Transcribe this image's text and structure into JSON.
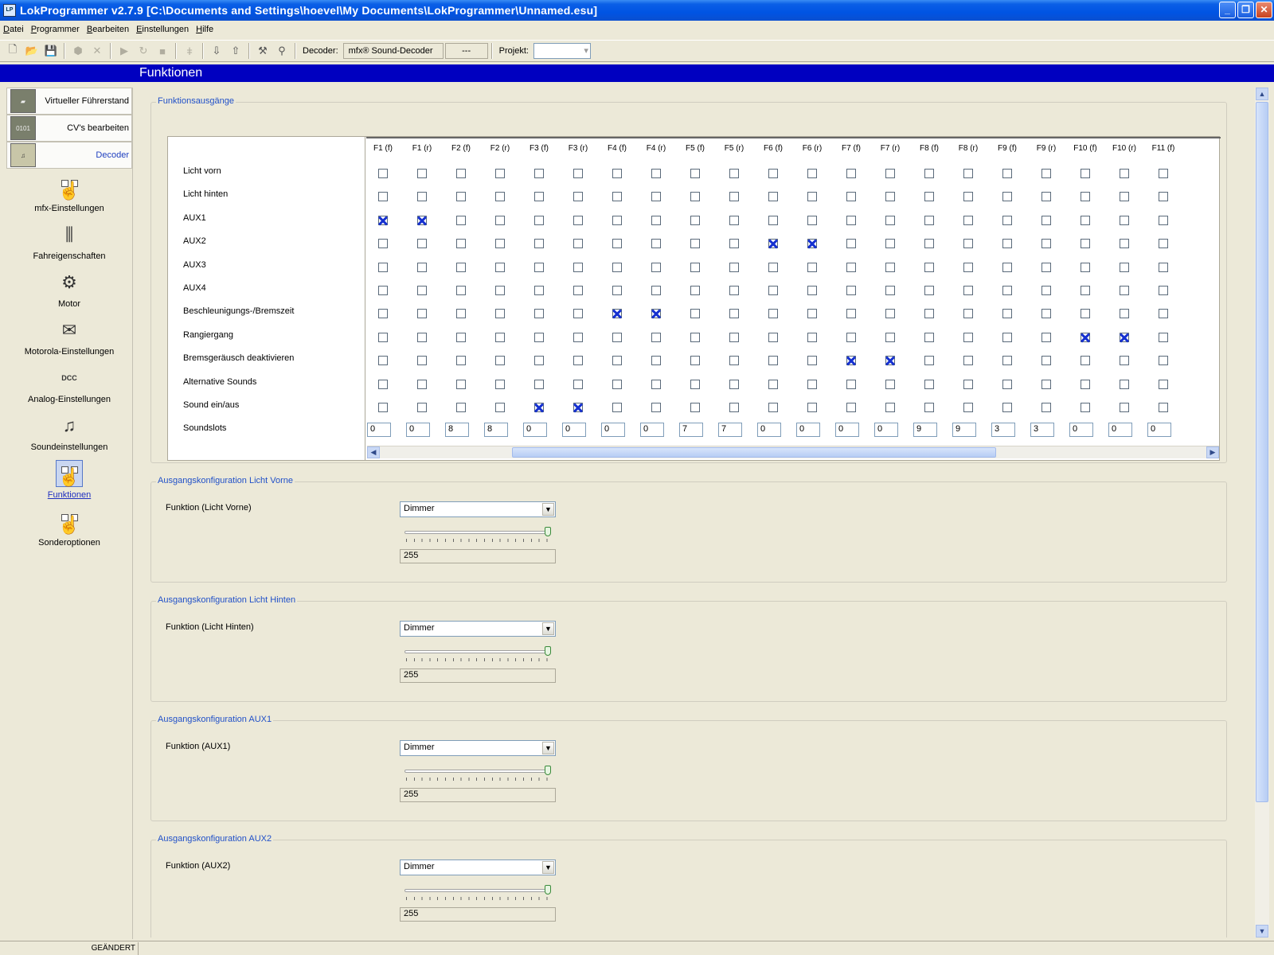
{
  "window": {
    "title": "LokProgrammer  v2.7.9  [C:\\Documents and Settings\\hoevel\\My Documents\\LokProgrammer\\Unnamed.esu]",
    "icon_text": "LP"
  },
  "menu": [
    "Datei",
    "Programmer",
    "Bearbeiten",
    "Einstellungen",
    "Hilfe"
  ],
  "toolbar": {
    "decoder_label": "Decoder:",
    "decoder_value": "mfx® Sound-Decoder",
    "decoder_extra": "---",
    "projekt_label": "Projekt:"
  },
  "header": {
    "title": "Funktionen"
  },
  "sidebar": {
    "top": [
      {
        "label": "Virtueller Führerstand",
        "active": false
      },
      {
        "label": "CV's bearbeiten",
        "active": false
      },
      {
        "label": "Decoder",
        "active": true
      }
    ],
    "items": [
      {
        "label": "mfx-Einstellungen",
        "icon": "mfx-icon"
      },
      {
        "label": "Fahreigenschaften",
        "icon": "sliders-icon"
      },
      {
        "label": "Motor",
        "icon": "motor-icon"
      },
      {
        "label": "Motorola-Einstellungen",
        "icon": "envelope-icon"
      },
      {
        "label": "Analog-Einstellungen",
        "icon": "dcc-gauge-icon"
      },
      {
        "label": "Soundeinstellungen",
        "icon": "music-icon"
      },
      {
        "label": "Funktionen",
        "icon": "functions-icon",
        "active": true
      },
      {
        "label": "Sonderoptionen",
        "icon": "special-options-icon"
      }
    ],
    "icon_text": {
      "dcc": "DCC"
    }
  },
  "function_outputs": {
    "title": "Funktionsausgänge",
    "columns": [
      "F1 (f)",
      "F1 (r)",
      "F2 (f)",
      "F2 (r)",
      "F3 (f)",
      "F3 (r)",
      "F4 (f)",
      "F4 (r)",
      "F5 (f)",
      "F5 (r)",
      "F6 (f)",
      "F6 (r)",
      "F7 (f)",
      "F7 (r)",
      "F8 (f)",
      "F8 (r)",
      "F9 (f)",
      "F9 (r)",
      "F10 (f)",
      "F10 (r)",
      "F11 (f)"
    ],
    "rows": [
      {
        "label": "Licht vorn",
        "checked": []
      },
      {
        "label": "Licht hinten",
        "checked": []
      },
      {
        "label": "AUX1",
        "checked": [
          0,
          1
        ]
      },
      {
        "label": "AUX2",
        "checked": [
          10,
          11
        ]
      },
      {
        "label": "AUX3",
        "checked": []
      },
      {
        "label": "AUX4",
        "checked": []
      },
      {
        "label": "Beschleunigungs-/Bremszeit",
        "checked": [
          6,
          7
        ]
      },
      {
        "label": "Rangiergang",
        "checked": [
          18,
          19
        ]
      },
      {
        "label": "Bremsgeräusch deaktivieren",
        "checked": [
          12,
          13
        ]
      },
      {
        "label": "Alternative Sounds",
        "checked": []
      },
      {
        "label": "Sound ein/aus",
        "checked": [
          4,
          5
        ]
      }
    ],
    "soundslots_label": "Soundslots",
    "soundslots": [
      "0",
      "0",
      "8",
      "8",
      "0",
      "0",
      "0",
      "0",
      "7",
      "7",
      "0",
      "0",
      "0",
      "0",
      "9",
      "9",
      "3",
      "3",
      "0",
      "0",
      "0"
    ]
  },
  "output_configs": [
    {
      "title": "Ausgangskonfiguration Licht Vorne",
      "label": "Funktion (Licht Vorne)",
      "mode": "Dimmer",
      "value": "255",
      "level": 1.0
    },
    {
      "title": "Ausgangskonfiguration Licht Hinten",
      "label": "Funktion (Licht Hinten)",
      "mode": "Dimmer",
      "value": "255",
      "level": 1.0
    },
    {
      "title": "Ausgangskonfiguration AUX1",
      "label": "Funktion (AUX1)",
      "mode": "Dimmer",
      "value": "255",
      "level": 1.0
    },
    {
      "title": "Ausgangskonfiguration AUX2",
      "label": "Funktion (AUX2)",
      "mode": "Dimmer",
      "value": "255",
      "level": 1.0
    }
  ],
  "statusbar": {
    "status": "GEÄNDERT"
  }
}
